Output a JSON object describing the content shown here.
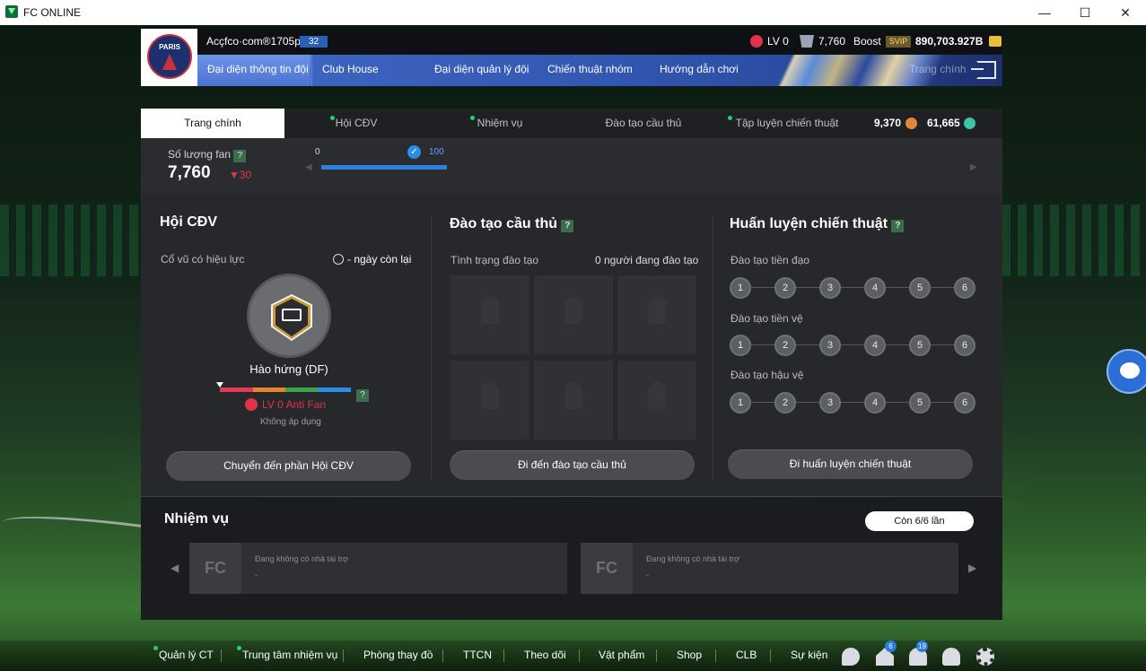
{
  "window": {
    "title": "FC ONLINE",
    "minimize": "—",
    "maximize": "☐",
    "close": "✕"
  },
  "header": {
    "club_badge_text": "PARIS",
    "username": "Acçfco·com®1705p",
    "user_level": "32",
    "antifan_level": "LV 0",
    "fan_count": "7,760",
    "boost_label": "Boost",
    "svip_label": "SVIP",
    "coins": "890,703.927B"
  },
  "nav": {
    "items": [
      "Đại diện thông tin đội",
      "Club House",
      "Đại diện quản lý đội",
      "Chiến thuật nhóm",
      "Hướng dẫn chơi",
      "Trang chính"
    ]
  },
  "tabs": {
    "items": [
      {
        "label": "Trang chính",
        "active": true,
        "dot": false
      },
      {
        "label": "Hội CĐV",
        "active": false,
        "dot": true
      },
      {
        "label": "Nhiệm vụ",
        "active": false,
        "dot": true
      },
      {
        "label": "Đào tạo cầu thủ",
        "active": false,
        "dot": false
      },
      {
        "label": "Tập luyện chiến thuật",
        "active": false,
        "dot": true
      }
    ],
    "currency_1": "9,370",
    "currency_2": "61,665"
  },
  "fans": {
    "label": "Số lượng fan",
    "help": "?",
    "count": "7,760",
    "change": "▼30",
    "progress_min": "0",
    "progress_max": "100"
  },
  "supporters": {
    "title": "Hội CĐV",
    "cheer_label": "Cổ vũ có hiệu lực",
    "days_left": "- ngày còn lại",
    "cheer_name": "Hào hứng (DF)",
    "help": "?",
    "antifan_status": "LV 0 Anti Fan",
    "not_applied": "Không áp dụng",
    "button": "Chuyển đến phần Hội CĐV",
    "meter_colors": [
      "#e23a55",
      "#e8832e",
      "#3ca34a",
      "#2a8ee8"
    ]
  },
  "training": {
    "title": "Đào tạo cầu thủ",
    "help": "?",
    "status_label": "Tình trạng đào tạo",
    "count_label": "0 người đang đào tạo",
    "button": "Đi đến đào tạo cầu thủ"
  },
  "tactics": {
    "title": "Huấn luyện chiến thuật",
    "help": "?",
    "rows": [
      {
        "label": "Đào tạo tiền đạo",
        "steps": [
          "1",
          "2",
          "3",
          "4",
          "5",
          "6"
        ]
      },
      {
        "label": "Đào tạo tiền vệ",
        "steps": [
          "1",
          "2",
          "3",
          "4",
          "5",
          "6"
        ]
      },
      {
        "label": "Đào tạo hậu vệ",
        "steps": [
          "1",
          "2",
          "3",
          "4",
          "5",
          "6"
        ]
      }
    ],
    "button": "Đi huấn luyện chiến thuật"
  },
  "missions": {
    "title": "Nhiệm vụ",
    "remaining": "Còn 6/6 lần",
    "cards": [
      {
        "text": "Đang không có nhà tài trợ",
        "sub": "-"
      },
      {
        "text": "Đang không có nhà tài trợ",
        "sub": "-"
      }
    ]
  },
  "bottom_nav": {
    "items": [
      "Quản lý CT",
      "Trung tâm nhiệm vụ",
      "Phòng thay đồ",
      "TTCN",
      "Theo dõi",
      "Vật phẩm",
      "Shop",
      "CLB",
      "Sự kiện"
    ],
    "badge_home": "6",
    "badge_bell": "19"
  }
}
